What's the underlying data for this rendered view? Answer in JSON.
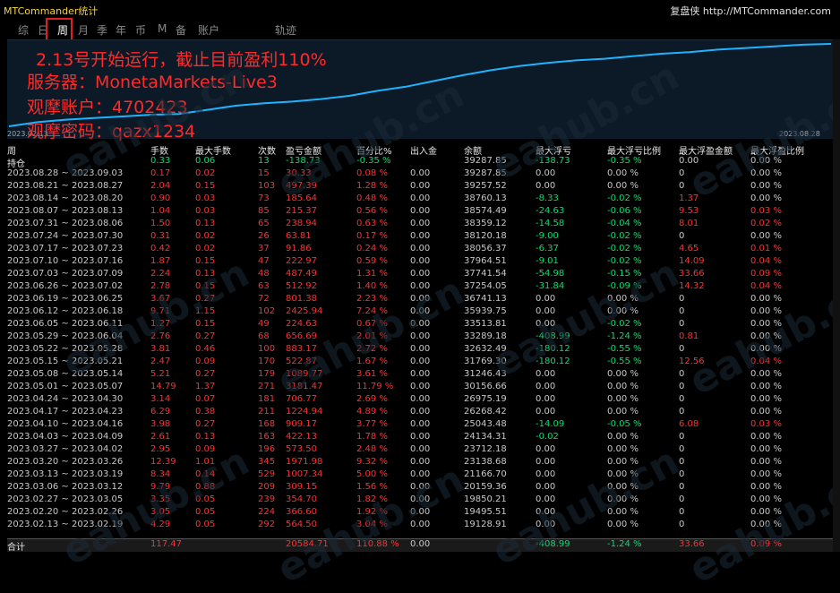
{
  "window": {
    "title": "MTCommander统计",
    "brand": "复盘侠 http://MTCommander.com"
  },
  "tabs": [
    "综",
    "日",
    "周",
    "月",
    "季",
    "年",
    "币",
    "M",
    "备",
    "账户",
    "轨迹"
  ],
  "active_tab": "周",
  "chart": {
    "date_start": "2023.02.13",
    "date_end": "2023.08.28",
    "line_color": "#1fb3ff",
    "values": [
      0,
      0.05,
      0.08,
      0.1,
      0.12,
      0.14,
      0.15,
      0.2,
      0.25,
      0.28,
      0.3,
      0.33,
      0.37,
      0.43,
      0.48,
      0.55,
      0.62,
      0.68,
      0.73,
      0.77,
      0.8,
      0.82,
      0.85,
      0.88,
      0.9,
      0.93,
      0.95,
      0.97,
      0.99,
      1.0
    ]
  },
  "overlay": [
    "2.13号开始运行，截止目前盈利110%",
    "服务器：MonetaMarkets-Live3",
    "观摩账户：4702423",
    "观摩密码：qazx1234"
  ],
  "watermark": "eahub.cn",
  "columns": [
    "周",
    "手数",
    "最大手数",
    "次数",
    "盈亏金额",
    "百分比%",
    "出入金",
    "余额",
    "最大浮亏",
    "最大浮亏比例",
    "最大浮盈金额",
    "最大浮盈比例"
  ],
  "holding": [
    "持仓",
    "0.33",
    "0.06",
    "13",
    "-138.73",
    "-0.35 %",
    "",
    "39287.85",
    "-138.73",
    "-0.35 %",
    "0.00",
    "0.00 %"
  ],
  "rows": [
    [
      "2023.08.28 ~ 2023.09.03",
      "0.17",
      "0.02",
      "15",
      "30.33",
      "0.08 %",
      "0.00",
      "39287.85",
      "0.00",
      "0.00 %",
      "0",
      "0.00 %"
    ],
    [
      "2023.08.21 ~ 2023.08.27",
      "2.04",
      "0.15",
      "103",
      "497.39",
      "1.28 %",
      "0.00",
      "39257.52",
      "0.00",
      "0.00 %",
      "0",
      "0.00 %"
    ],
    [
      "2023.08.14 ~ 2023.08.20",
      "0.90",
      "0.03",
      "73",
      "185.64",
      "0.48 %",
      "0.00",
      "38760.13",
      "-8.33",
      "-0.02 %",
      "1.37",
      "0.00 %"
    ],
    [
      "2023.08.07 ~ 2023.08.13",
      "1.04",
      "0.03",
      "85",
      "215.37",
      "0.56 %",
      "0.00",
      "38574.49",
      "-24.63",
      "-0.06 %",
      "9.53",
      "0.03 %"
    ],
    [
      "2023.07.31 ~ 2023.08.06",
      "1.50",
      "0.13",
      "65",
      "238.94",
      "0.63 %",
      "0.00",
      "38359.12",
      "-14.58",
      "-0.04 %",
      "8.01",
      "0.02 %"
    ],
    [
      "2023.07.24 ~ 2023.07.30",
      "0.31",
      "0.02",
      "26",
      "63.81",
      "0.17 %",
      "0.00",
      "38120.18",
      "-9.00",
      "-0.02 %",
      "0",
      "0.00 %"
    ],
    [
      "2023.07.17 ~ 2023.07.23",
      "0.42",
      "0.02",
      "37",
      "91.86",
      "0.24 %",
      "0.00",
      "38056.37",
      "-6.37",
      "-0.02 %",
      "4.65",
      "0.01 %"
    ],
    [
      "2023.07.10 ~ 2023.07.16",
      "1.87",
      "0.15",
      "47",
      "222.97",
      "0.59 %",
      "0.00",
      "37964.51",
      "-9.01",
      "-0.02 %",
      "14.09",
      "0.04 %"
    ],
    [
      "2023.07.03 ~ 2023.07.09",
      "2.24",
      "0.13",
      "48",
      "487.49",
      "1.31 %",
      "0.00",
      "37741.54",
      "-54.98",
      "-0.15 %",
      "33.66",
      "0.09 %"
    ],
    [
      "2023.06.26 ~ 2023.07.02",
      "2.78",
      "0.15",
      "63",
      "512.92",
      "1.40 %",
      "0.00",
      "37254.05",
      "-31.84",
      "-0.09 %",
      "14.32",
      "0.04 %"
    ],
    [
      "2023.06.19 ~ 2023.06.25",
      "3.67",
      "0.27",
      "72",
      "801.38",
      "2.23 %",
      "0.00",
      "36741.13",
      "0.00",
      "0.00 %",
      "0",
      "0.00 %"
    ],
    [
      "2023.06.12 ~ 2023.06.18",
      "9.71",
      "1.15",
      "102",
      "2425.94",
      "7.24 %",
      "0.00",
      "35939.75",
      "0.00",
      "0.00 %",
      "0",
      "0.00 %"
    ],
    [
      "2023.06.05 ~ 2023.06.11",
      "1.27",
      "0.15",
      "49",
      "224.63",
      "0.67 %",
      "0.00",
      "33513.81",
      "0.00",
      "-0.02 %",
      "0",
      "0.00 %"
    ],
    [
      "2023.05.29 ~ 2023.06.04",
      "2.76",
      "0.27",
      "68",
      "656.69",
      "2.01 %",
      "0.00",
      "33289.18",
      "-408.99",
      "-1.24 %",
      "0.81",
      "0.00 %"
    ],
    [
      "2023.05.22 ~ 2023.05.28",
      "3.81",
      "0.46",
      "100",
      "883.17",
      "2.72 %",
      "0.00",
      "32632.49",
      "-180.12",
      "-0.55 %",
      "0",
      "0.00 %"
    ],
    [
      "2023.05.15 ~ 2023.05.21",
      "2.47",
      "0.09",
      "170",
      "522.87",
      "1.67 %",
      "0.00",
      "31769.30",
      "-180.12",
      "-0.55 %",
      "12.56",
      "0.04 %"
    ],
    [
      "2023.05.08 ~ 2023.05.14",
      "5.21",
      "0.27",
      "179",
      "1089.77",
      "3.61 %",
      "0.00",
      "31246.43",
      "0.00",
      "0.00 %",
      "0",
      "0.00 %"
    ],
    [
      "2023.05.01 ~ 2023.05.07",
      "14.79",
      "1.37",
      "271",
      "3181.47",
      "11.79 %",
      "0.00",
      "30156.66",
      "0.00",
      "0.00 %",
      "0",
      "0.00 %"
    ],
    [
      "2023.04.24 ~ 2023.04.30",
      "3.14",
      "0.07",
      "181",
      "706.77",
      "2.69 %",
      "0.00",
      "26975.19",
      "0.00",
      "0.00 %",
      "0",
      "0.00 %"
    ],
    [
      "2023.04.17 ~ 2023.04.23",
      "6.29",
      "0.38",
      "211",
      "1224.94",
      "4.89 %",
      "0.00",
      "26268.42",
      "0.00",
      "0.00 %",
      "0",
      "0.00 %"
    ],
    [
      "2023.04.10 ~ 2023.04.16",
      "3.98",
      "0.27",
      "168",
      "909.17",
      "3.77 %",
      "0.00",
      "25043.48",
      "-14.09",
      "-0.05 %",
      "6.08",
      "0.03 %"
    ],
    [
      "2023.04.03 ~ 2023.04.09",
      "2.61",
      "0.13",
      "163",
      "422.13",
      "1.78 %",
      "0.00",
      "24134.31",
      "-0.02",
      "0.00 %",
      "0",
      "0.00 %"
    ],
    [
      "2023.03.27 ~ 2023.04.02",
      "2.95",
      "0.09",
      "196",
      "573.50",
      "2.48 %",
      "0.00",
      "23712.18",
      "0.00",
      "0.00 %",
      "0",
      "0.00 %"
    ],
    [
      "2023.03.20 ~ 2023.03.26",
      "12.39",
      "1.01",
      "345",
      "1971.98",
      "9.32 %",
      "0.00",
      "23138.68",
      "0.00",
      "0.00 %",
      "0",
      "0.00 %"
    ],
    [
      "2023.03.13 ~ 2023.03.19",
      "8.34",
      "0.14",
      "529",
      "1007.34",
      "5.00 %",
      "0.00",
      "21166.70",
      "0.00",
      "0.00 %",
      "0",
      "0.00 %"
    ],
    [
      "2023.03.06 ~ 2023.03.12",
      "9.79",
      "0.88",
      "209",
      "309.15",
      "1.56 %",
      "0.00",
      "20159.36",
      "0.00",
      "0.00 %",
      "0",
      "0.00 %"
    ],
    [
      "2023.02.27 ~ 2023.03.05",
      "3.35",
      "0.05",
      "239",
      "354.70",
      "1.82 %",
      "0.00",
      "19850.21",
      "0.00",
      "0.00 %",
      "0",
      "0.00 %"
    ],
    [
      "2023.02.20 ~ 2023.02.26",
      "3.05",
      "0.05",
      "224",
      "366.60",
      "1.92 %",
      "0.00",
      "19495.51",
      "0.00",
      "0.00 %",
      "0",
      "0.00 %"
    ],
    [
      "2023.02.13 ~ 2023.02.19",
      "4.29",
      "0.05",
      "292",
      "564.50",
      "3.04 %",
      "0.00",
      "19128.91",
      "0.00",
      "0.00 %",
      "0",
      "0.00 %"
    ]
  ],
  "total": [
    "合计",
    "117.47",
    "",
    "",
    "20584.71",
    "110.88 %",
    "0.00",
    "",
    "-408.99",
    "-1.24 %",
    "33.66",
    "0.09 %"
  ]
}
